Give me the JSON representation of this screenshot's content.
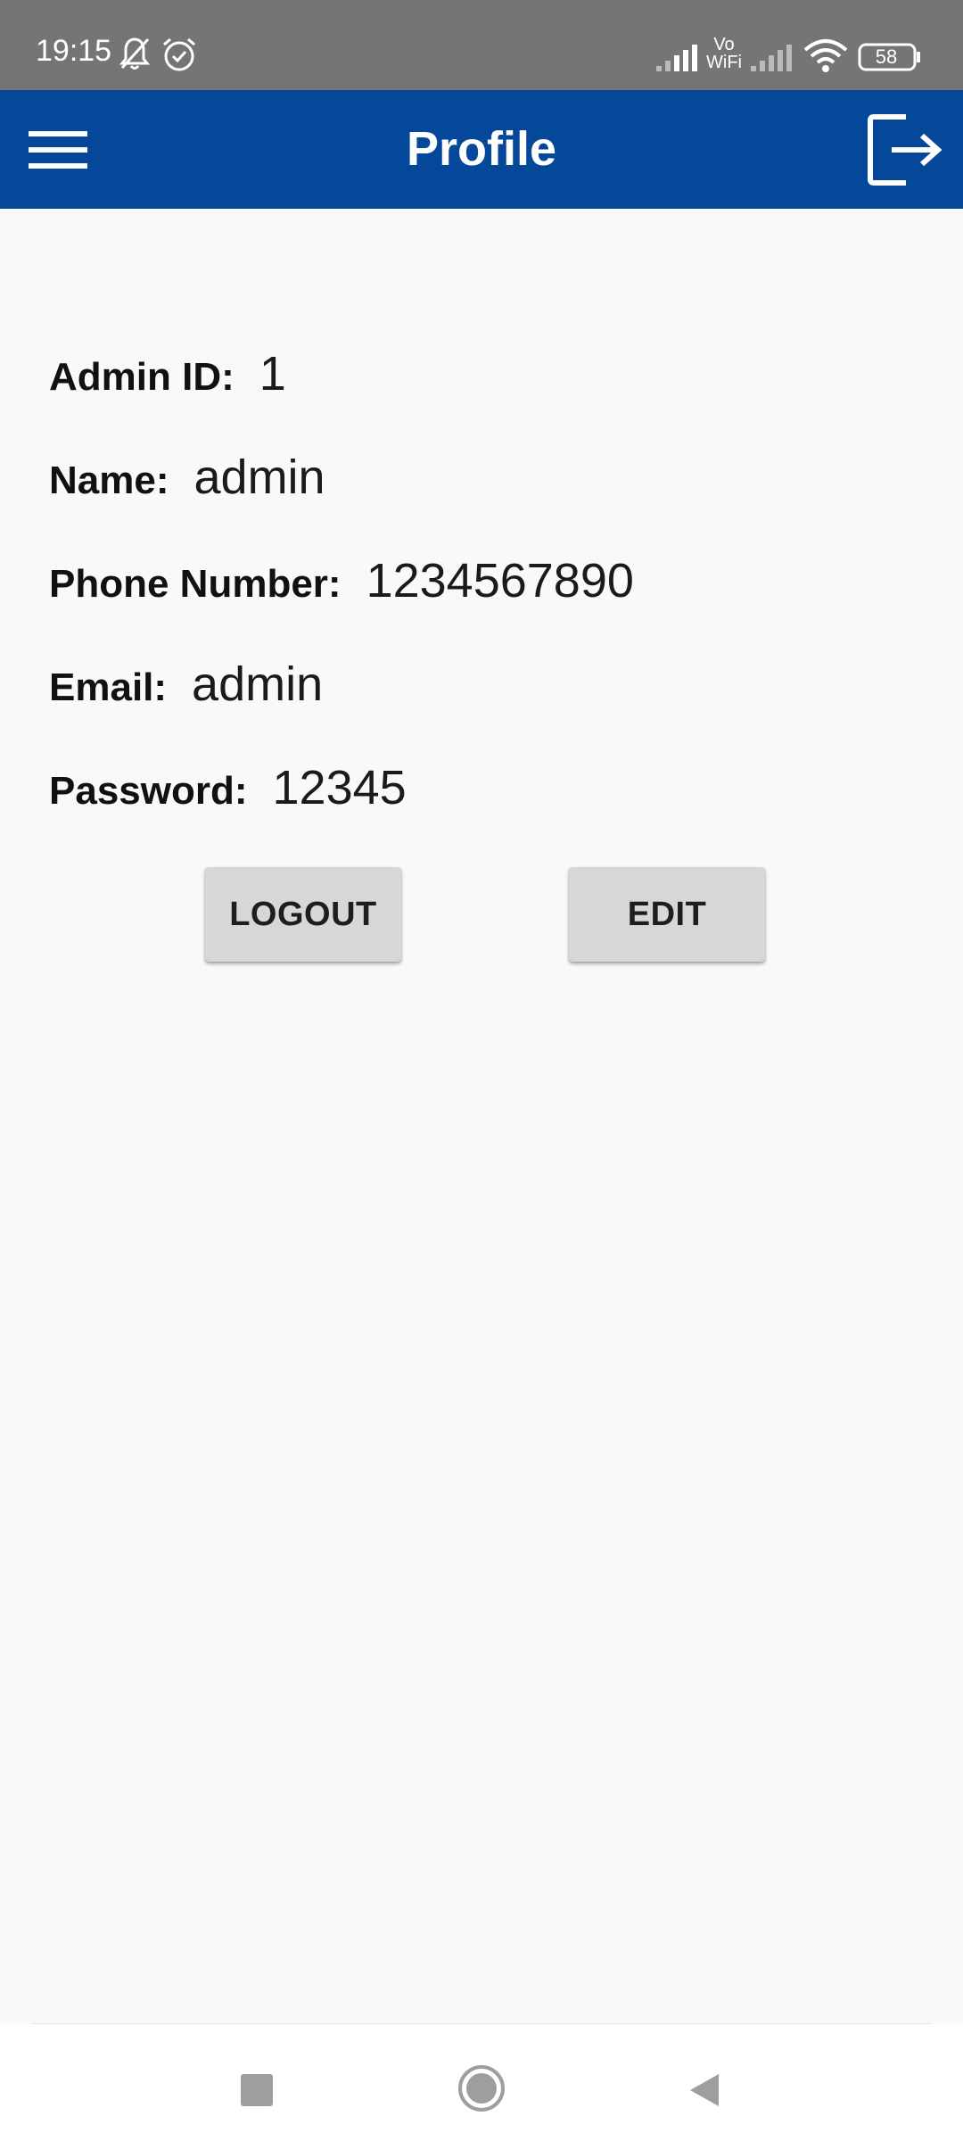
{
  "status_bar": {
    "time": "19:15",
    "vowifi_label_top": "Vo",
    "vowifi_label_bottom": "WiFi",
    "battery_level": "58",
    "icons": [
      "mute-bell-icon",
      "alarm-icon",
      "signal-icon",
      "vowifi-icon",
      "signal-icon",
      "wifi-icon",
      "battery-icon"
    ]
  },
  "app_bar": {
    "title": "Profile",
    "menu_icon": "hamburger-menu-icon",
    "action_icon": "logout-icon"
  },
  "profile": {
    "admin_id": {
      "label": "Admin ID:",
      "value": "1"
    },
    "name": {
      "label": "Name:",
      "value": "admin"
    },
    "phone": {
      "label": "Phone Number:",
      "value": "1234567890"
    },
    "email": {
      "label": "Email:",
      "value": "admin"
    },
    "password": {
      "label": "Password:",
      "value": "12345"
    }
  },
  "buttons": {
    "logout_label": "LOGOUT",
    "edit_label": "EDIT"
  },
  "nav_bar": {
    "icons": [
      "recents-square-icon",
      "home-circle-icon",
      "back-triangle-icon"
    ]
  },
  "colors": {
    "status_bar": "#757575",
    "app_bar": "#054799",
    "background": "#f9f9f9",
    "button": "#d7d7d7"
  }
}
